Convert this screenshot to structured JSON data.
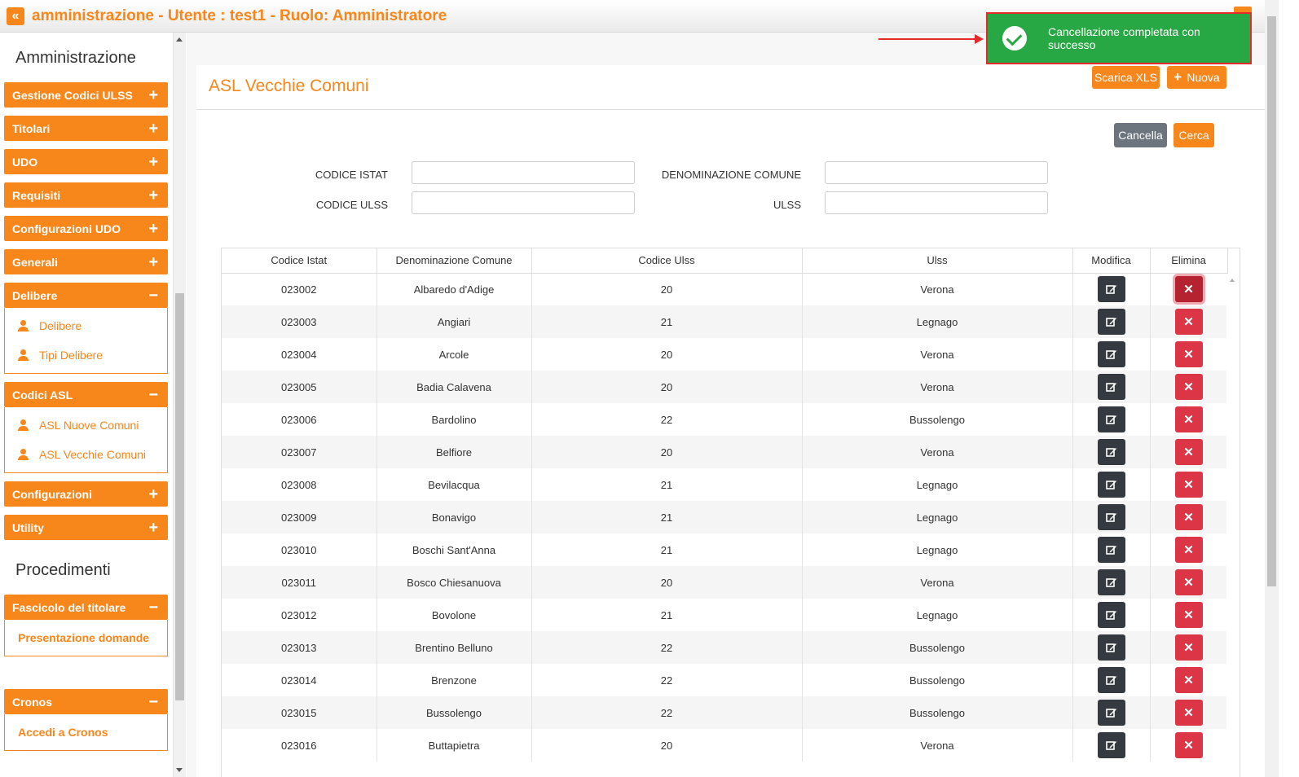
{
  "header": {
    "collapse_icon": "double-chevron-left-icon",
    "title": "amministrazione - Utente : test1 - Ruolo: Amministratore"
  },
  "sidebar": {
    "section1_title": "Amministrazione",
    "section2_title": "Procedimenti",
    "groups": [
      {
        "label": "Gestione Codici ULSS",
        "sign": "+"
      },
      {
        "label": "Titolari",
        "sign": "+"
      },
      {
        "label": "UDO",
        "sign": "+"
      },
      {
        "label": "Requisiti",
        "sign": "+"
      },
      {
        "label": "Configurazioni UDO",
        "sign": "+"
      },
      {
        "label": "Generali",
        "sign": "+"
      },
      {
        "label": "Delibere",
        "sign": "−",
        "items": [
          "Delibere",
          "Tipi Delibere"
        ]
      },
      {
        "label": "Codici ASL",
        "sign": "−",
        "items": [
          "ASL Nuove Comuni",
          "ASL Vecchie Comuni"
        ]
      },
      {
        "label": "Configurazioni",
        "sign": "+"
      },
      {
        "label": "Utility",
        "sign": "+"
      }
    ],
    "procedimenti": [
      {
        "label": "Fascicolo del titolare",
        "sign": "−",
        "items": [
          "Presentazione domande"
        ]
      },
      {
        "label": "Cronos",
        "sign": "−",
        "items": [
          "Accedi a Cronos"
        ]
      }
    ]
  },
  "page": {
    "title": "ASL Vecchie Comuni",
    "scarica_label": "Scarica XLS",
    "nuova_label": "Nuova",
    "cancella_label": "Cancella",
    "cerca_label": "Cerca"
  },
  "filters": {
    "codice_istat_label": "CODICE ISTAT",
    "denominazione_label": "DENOMINAZIONE COMUNE",
    "codice_ulss_label": "CODICE ULSS",
    "ulss_label": "ULSS",
    "codice_istat_value": "",
    "denominazione_value": "",
    "codice_ulss_value": "",
    "ulss_value": ""
  },
  "table": {
    "columns": [
      "Codice Istat",
      "Denominazione Comune",
      "Codice Ulss",
      "Ulss",
      "Modifica",
      "Elimina"
    ],
    "rows": [
      [
        "023002",
        "Albaredo d'Adige",
        "20",
        "Verona"
      ],
      [
        "023003",
        "Angiari",
        "21",
        "Legnago"
      ],
      [
        "023004",
        "Arcole",
        "20",
        "Verona"
      ],
      [
        "023005",
        "Badia Calavena",
        "20",
        "Verona"
      ],
      [
        "023006",
        "Bardolino",
        "22",
        "Bussolengo"
      ],
      [
        "023007",
        "Belfiore",
        "20",
        "Verona"
      ],
      [
        "023008",
        "Bevilacqua",
        "21",
        "Legnago"
      ],
      [
        "023009",
        "Bonavigo",
        "21",
        "Legnago"
      ],
      [
        "023010",
        "Boschi Sant'Anna",
        "21",
        "Legnago"
      ],
      [
        "023011",
        "Bosco Chiesanuova",
        "20",
        "Verona"
      ],
      [
        "023012",
        "Bovolone",
        "21",
        "Legnago"
      ],
      [
        "023013",
        "Brentino Belluno",
        "22",
        "Bussolengo"
      ],
      [
        "023014",
        "Brenzone",
        "22",
        "Bussolengo"
      ],
      [
        "023015",
        "Bussolengo",
        "22",
        "Bussolengo"
      ],
      [
        "023016",
        "Buttapietra",
        "20",
        "Verona"
      ]
    ]
  },
  "toast": {
    "message": "Cancellazione completata con successo",
    "icon": "check-circle-icon"
  },
  "colors": {
    "accent": "#f7861b",
    "success": "#28a745",
    "danger": "#dc3545",
    "dark": "#343a40"
  }
}
